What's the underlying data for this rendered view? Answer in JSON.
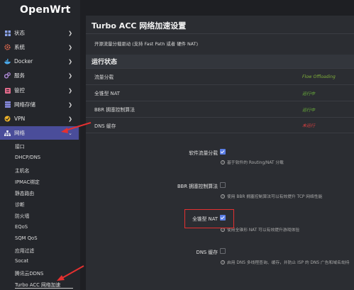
{
  "app": {
    "logo": "OpenWrt"
  },
  "sidebar": {
    "items": [
      {
        "label": "状态",
        "icon": "dashboard-icon"
      },
      {
        "label": "系统",
        "icon": "gear-icon"
      },
      {
        "label": "Docker",
        "icon": "docker-icon"
      },
      {
        "label": "服务",
        "icon": "services-icon"
      },
      {
        "label": "管控",
        "icon": "control-icon"
      },
      {
        "label": "网络存储",
        "icon": "storage-icon"
      },
      {
        "label": "VPN",
        "icon": "vpn-icon"
      },
      {
        "label": "网络",
        "icon": "network-icon"
      }
    ],
    "submenu": [
      "接口",
      "DHCP/DNS",
      "主机名",
      "IPMAC绑定",
      "静态路由",
      "诊断",
      "防火墙",
      "EQoS",
      "SQM QoS",
      "应用过滤",
      "Socat",
      "腾讯云DDNS",
      "Turbo ACC 网络加速"
    ]
  },
  "main": {
    "title": "Turbo ACC 网络加速设置",
    "description": "开源流量分载驱动 (支持 Fast Path 或者 硬件 NAT)",
    "status_section": "运行状态",
    "status_rows": [
      {
        "key": "流量分载",
        "value": "Flow Offloading",
        "color": "#7fae3a"
      },
      {
        "key": "全锥型 NAT",
        "value": "运行中",
        "color": "#6fb93a"
      },
      {
        "key": "BBR 拥塞控制算法",
        "value": "运行中",
        "color": "#6fb93a"
      },
      {
        "key": "DNS 缓存",
        "value": "未运行",
        "color": "#e04040"
      }
    ],
    "options": [
      {
        "label": "软件流量分载",
        "checked": true,
        "help": "基于软件的 Routing/NAT 分载"
      },
      {
        "label": "BBR 拥塞控制算法",
        "checked": false,
        "help": "使用 BBR 拥塞控制算法可以有效提升 TCP 网络性能"
      },
      {
        "label": "全锥型 NAT",
        "checked": true,
        "help": "使用全锥形 NAT 可以有效提升游戏体验"
      },
      {
        "label": "DNS 缓存",
        "checked": false,
        "help": "启用 DNS 多线程查询、缓存，并防止 ISP 的 DNS 广告和域名劫持"
      }
    ]
  },
  "colors": {
    "accent": "#4a4d9a",
    "checkbox": "#5b7ee6",
    "highlight": "#e53030"
  }
}
